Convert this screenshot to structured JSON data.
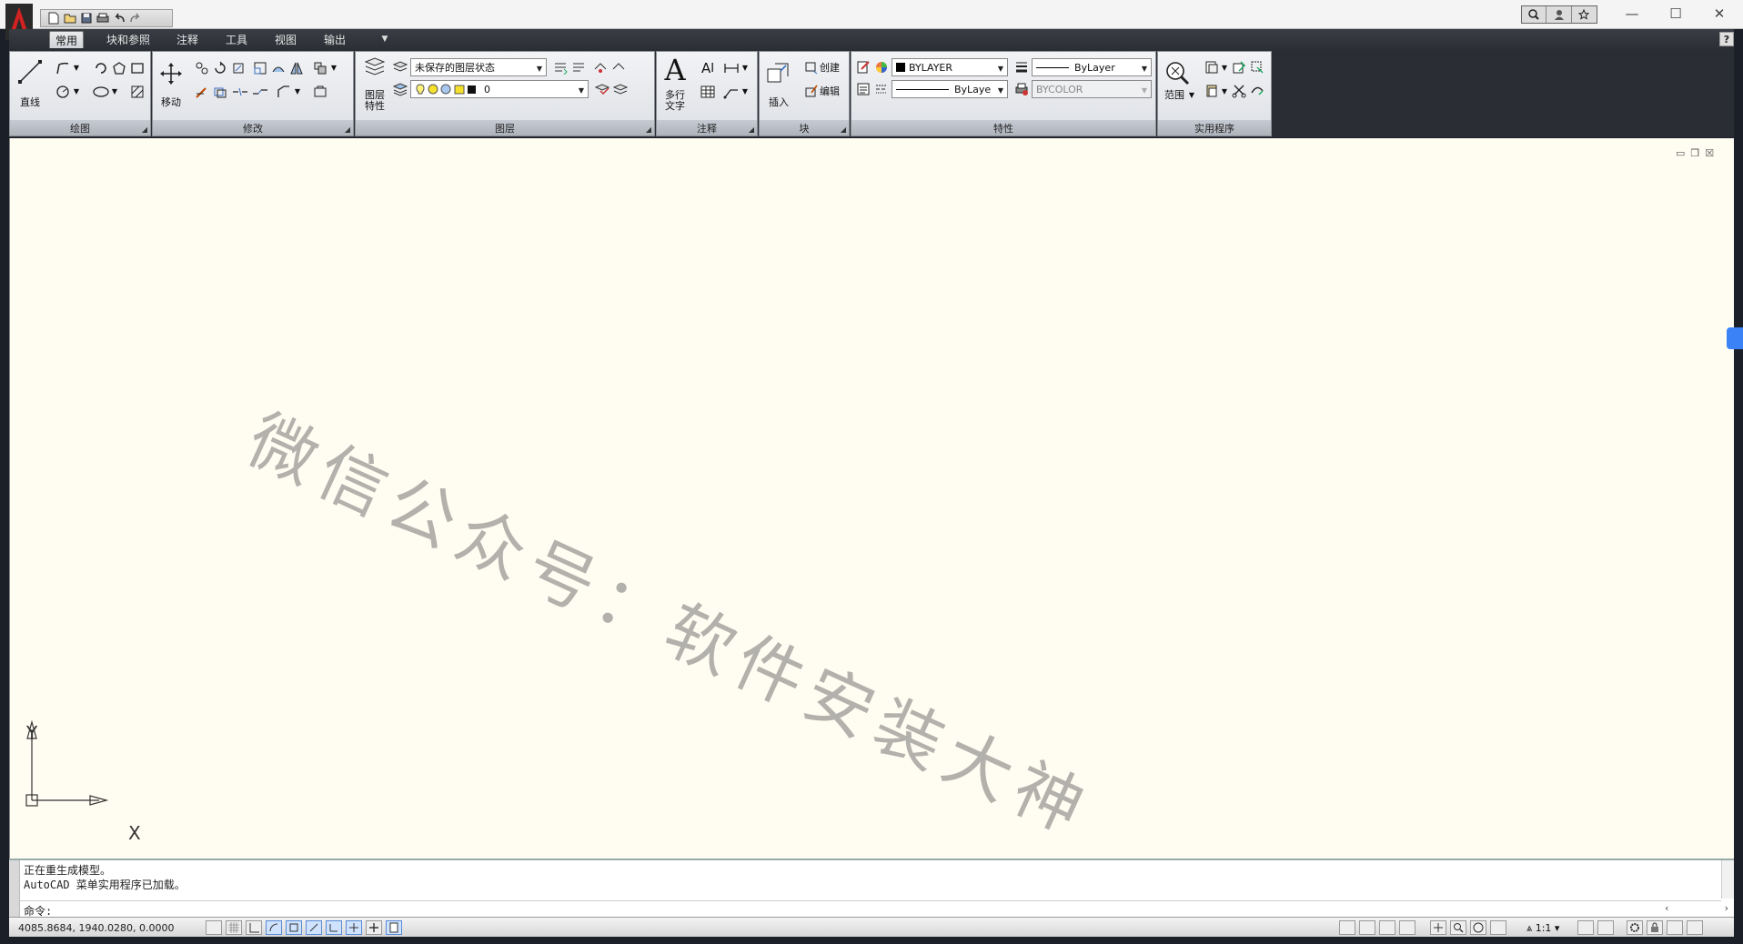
{
  "title_bar": {
    "logo_letter": "A",
    "quick_access": [
      "new-icon",
      "open-icon",
      "save-icon",
      "print-icon",
      "undo-icon",
      "redo-icon"
    ],
    "tools": [
      "search-icon",
      "user-icon",
      "star-icon"
    ]
  },
  "window_controls": {
    "minimize": "—",
    "maximize": "☐",
    "close": "✕"
  },
  "tabs": [
    "常用",
    "块和参照",
    "注释",
    "工具",
    "视图",
    "输出"
  ],
  "active_tab": "常用",
  "help_label": "?",
  "panels": {
    "draw": {
      "title": "绘图",
      "line_label": "直线"
    },
    "modify": {
      "title": "修改",
      "move_label": "移动"
    },
    "layers": {
      "title": "图层",
      "layer_props_label_1": "图层",
      "layer_props_label_2": "特性",
      "layer_state": "未保存的图层状态",
      "current_layer": "0"
    },
    "annotation": {
      "title": "注释",
      "mtext_label_1": "多行",
      "mtext_label_2": "文字"
    },
    "block": {
      "title": "块",
      "insert_label": "插入",
      "create_label": "创建",
      "edit_label": "编辑"
    },
    "properties": {
      "title": "特性",
      "color": "BYLAYER",
      "lineweight": "ByLayer",
      "linetype": "ByLaye",
      "plotstyle": "BYCOLOR"
    },
    "utilities": {
      "title": "实用程序",
      "zoom_label": "范围"
    }
  },
  "watermark": "微信公众号：软件安装大神",
  "ucs": {
    "x": "X",
    "y": "Y"
  },
  "command": {
    "line1": "正在重生成模型。",
    "line2": "AutoCAD 菜单实用程序已加载。",
    "prompt": "命令:"
  },
  "status": {
    "coords": "4085.8684, 1940.0280, 0.0000",
    "scale": "1:1"
  },
  "colors": {
    "canvas": "#fffdf2",
    "tab_bar": "#2c2f35",
    "accent": "#cc1f1f"
  }
}
